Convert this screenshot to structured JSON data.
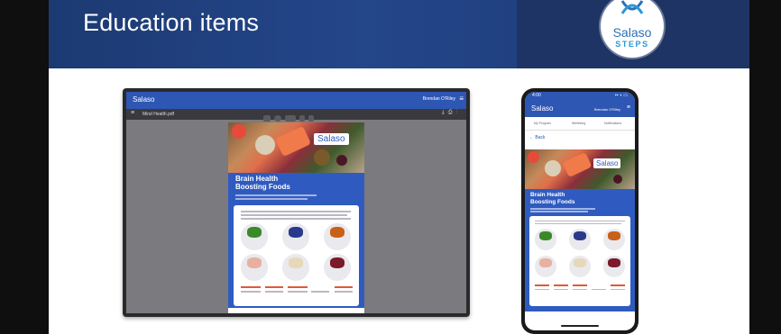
{
  "slide": {
    "title": "Education items",
    "logo": {
      "name": "Salaso",
      "sub": "STEPS"
    }
  },
  "desktop_view": {
    "brand": "Salaso",
    "user": "Brendan O'Riley",
    "toolbar_file": "Mind Health.pdf",
    "poster": {
      "logo": "Salaso",
      "title_line1": "Brain Health",
      "title_line2": "Boosting Foods"
    }
  },
  "mobile_view": {
    "time": "4:00",
    "signal": "▪▪ ◗ ▭",
    "brand": "Salaso",
    "user": "Brendan O'Riley",
    "tabs": [
      "My Program",
      "Wellbeing",
      "Notifications"
    ],
    "back": "← Back",
    "poster": {
      "logo": "Salaso",
      "title_line1": "Brain Health",
      "title_line2": "Boosting Foods"
    }
  },
  "colors": {
    "header_blue": "#24468a",
    "app_blue": "#2e56b3",
    "accent_orange": "#e0583a"
  }
}
